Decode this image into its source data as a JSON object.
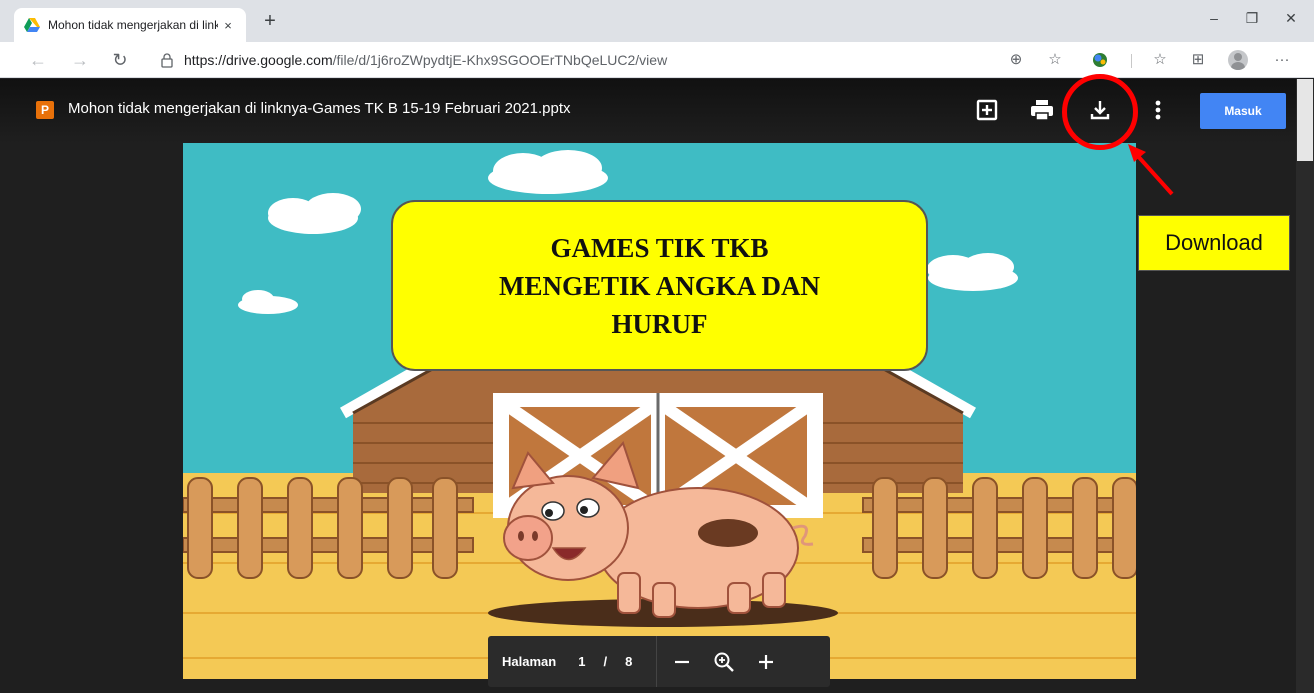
{
  "browser": {
    "tab_title": "Mohon tidak mengerjakan di linknya-Games TK B 15-19 Februari 2021.pptx",
    "tab_close": "×",
    "new_tab": "+",
    "url_domain": "https://drive.google.com",
    "url_path": "/file/d/1j6roZWpydtjE-Khx9SGOOErTNbQeLUC2/view",
    "window_controls": [
      "–",
      "❐",
      "✕"
    ],
    "more_menu": "···"
  },
  "viewer": {
    "file_type_letter": "P",
    "file_title": "Mohon tidak mengerjakan di linknya-Games TK B 15-19 Februari 2021.pptx",
    "sign_in_label": "Masuk"
  },
  "slide": {
    "title_lines": [
      "GAMES TIK TKB",
      "MENGETIK ANGKA DAN",
      "HURUF"
    ]
  },
  "page_controls": {
    "label": "Halaman",
    "current": "1",
    "separator": "/",
    "total": "8"
  },
  "annotation": {
    "callout_text": "Download",
    "color": "#ff0000"
  },
  "colors": {
    "drive_blue": "#4285f4",
    "pptx_orange": "#e8710a",
    "viewer_bg": "#1f1f1f"
  }
}
